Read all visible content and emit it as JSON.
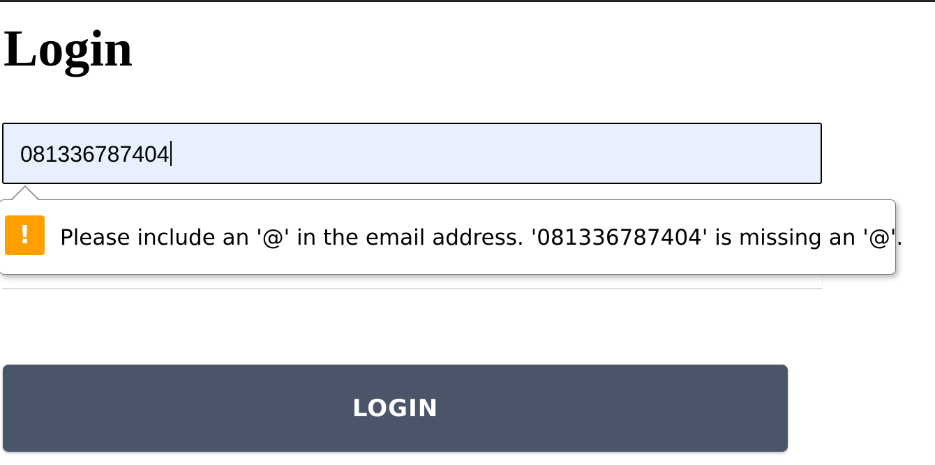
{
  "page": {
    "title": "Login"
  },
  "email_field": {
    "value": "081336787404"
  },
  "validation_tooltip": {
    "icon": "warning-icon",
    "icon_glyph": "!",
    "icon_color": "#ffa000",
    "message": "Please include an '@' in the email address. '081336787404' is missing an '@'."
  },
  "login_button": {
    "label": "LOGIN",
    "color": "#4b5569"
  },
  "colors": {
    "input_autofill_bg": "#e8f0fe",
    "top_border": "#222222"
  }
}
